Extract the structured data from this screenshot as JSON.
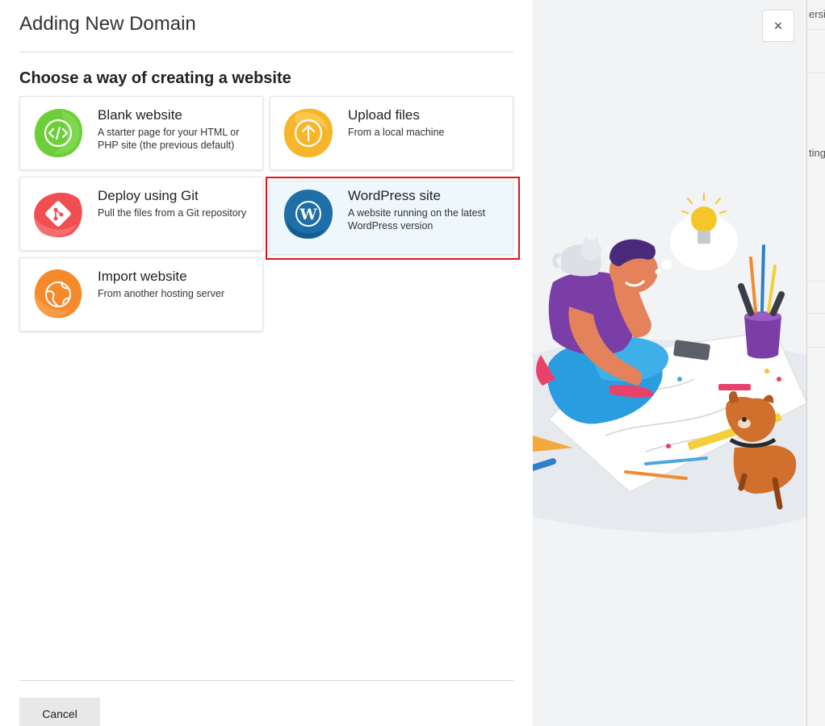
{
  "dialog": {
    "title": "Adding New Domain",
    "subtitle": "Choose a way of creating a website",
    "cancel_label": "Cancel",
    "close_label": "×"
  },
  "options": [
    {
      "title": "Blank website",
      "description": "A starter page for your HTML or PHP site (the previous default)",
      "icon": "code-icon",
      "color": "#6ccf3a"
    },
    {
      "title": "Upload files",
      "description": "From a local machine",
      "icon": "upload-icon",
      "color": "#f7b52a"
    },
    {
      "title": "Deploy using Git",
      "description": "Pull the files from a Git repository",
      "icon": "git-icon",
      "color": "#f04e51"
    },
    {
      "title": "WordPress site",
      "description": "A website running on the latest WordPress version",
      "icon": "wordpress-icon",
      "color": "#1e6ea7",
      "selected": true
    },
    {
      "title": "Import website",
      "description": "From another hosting server",
      "icon": "globe-icon",
      "color": "#f48a2b"
    }
  ],
  "background_page": {
    "fragments": [
      "ersi",
      "ting"
    ]
  },
  "colors": {
    "selection_outline": "#e0141e",
    "illustration_bg": "#f1f3f5"
  }
}
